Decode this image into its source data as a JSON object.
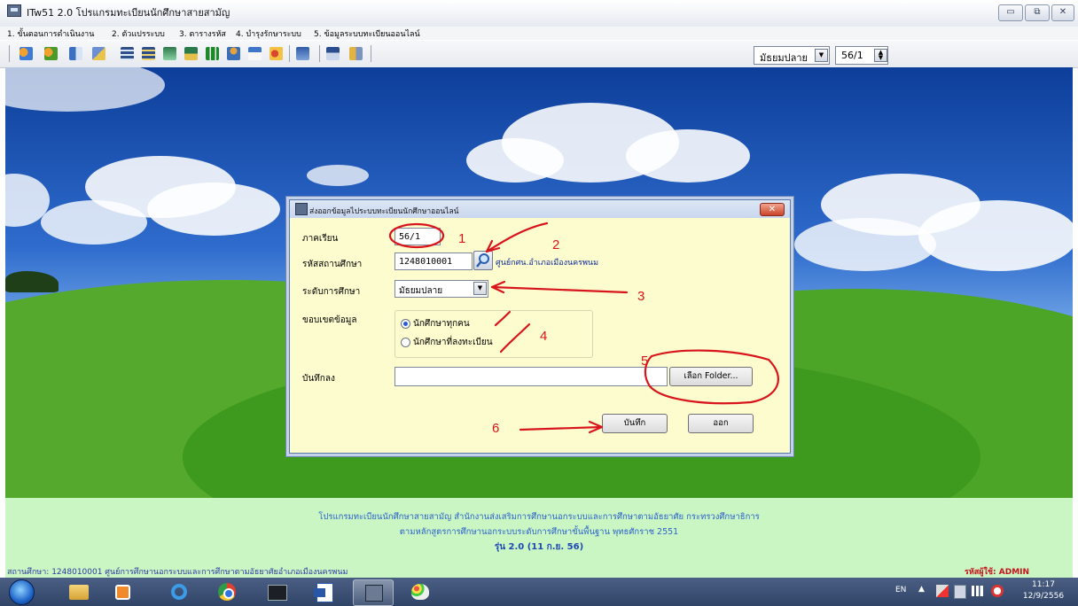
{
  "window": {
    "title": "ITw51 2.0 โปรแกรมทะเบียนนักศึกษาสายสามัญ",
    "controls": {
      "minimize": "▭",
      "maximize": "⧉",
      "close": "✕"
    }
  },
  "menu": [
    "1. ขั้นตอนการดำเนินงาน",
    "2. ตัวแปรระบบ",
    "3. ตารางรหัส",
    "4. บำรุงรักษาระบบ",
    "5. ข้อมูลระบบทะเบียนออนไลน์"
  ],
  "toolbar": {
    "level_select": "มัธยมปลาย",
    "term_spinner": "56/1",
    "icons": [
      "users-icon",
      "users-edit-icon",
      "record-icon",
      "edit-icon",
      "grid-icon",
      "grid-edit-icon",
      "book-icon",
      "book-edit-icon",
      "chart-icon",
      "person-icon",
      "card-icon",
      "chat-icon",
      "report-icon",
      "save-icon",
      "exit-icon"
    ]
  },
  "dialog": {
    "title": "ส่งออกข้อมูลไประบบทะเบียนนักศึกษาออนไลน์",
    "close": "✕",
    "semester_label": "ภาคเรียน",
    "semester_value": "56/1",
    "school_code_label": "รหัสสถานศึกษา",
    "school_code_value": "1248010001",
    "school_name": "ศูนย์กศน.อำเภอเมืองนครพนม",
    "level_label": "ระดับการศึกษา",
    "level_value": "มัธยมปลาย",
    "scope_label": "ขอบเขตข้อมูล",
    "scope_options": [
      "นักศึกษาทุกคน",
      "นักศึกษาที่ลงทะเบียน"
    ],
    "scope_selected": 0,
    "save_to_label": "บันทึกลง",
    "save_to_value": "",
    "browse_button": "เลือก Folder...",
    "save_button": "บันทึก",
    "exit_button": "ออก",
    "annotations": [
      "1",
      "2",
      "3",
      "4",
      "5",
      "6"
    ],
    "annotation_color": "#d8141c"
  },
  "footer": {
    "line1": "โปรแกรมทะเบียนนักศึกษาสายสามัญ สำนักงานส่งเสริมการศึกษานอกระบบและการศึกษาตามอัธยาศัย กระทรวงศึกษาธิการ",
    "line2": "ตามหลักสูตรการศึกษานอกระบบระดับการศึกษาขั้นพื้นฐาน พุทธศักราช 2551",
    "version": "รุ่น 2.0 (11 ก.ย. 56)",
    "status_left": "สถานศึกษา: 1248010001  ศูนย์การศึกษานอกระบบและการศึกษาตามอัธยาศัยอำเภอเมืองนครพนม",
    "status_right": "รหัสผู้ใช้: ADMIN"
  },
  "taskbar": {
    "apps": [
      "file-explorer-icon",
      "media-player-icon",
      "internet-explorer-icon",
      "chrome-icon",
      "terminal-icon",
      "word-icon",
      "itw51-app-icon",
      "paint-icon"
    ],
    "language": "EN",
    "time": "11:17",
    "date": "12/9/2556"
  }
}
